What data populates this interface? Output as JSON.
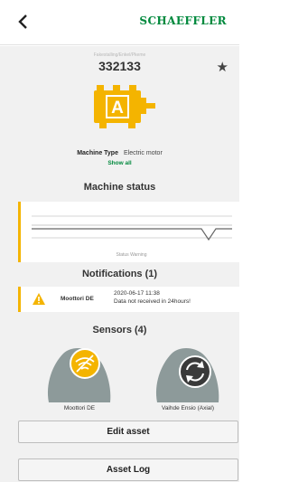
{
  "header": {
    "brand": "SCHAEFFLER",
    "back_icon": "back-chevron-icon"
  },
  "asset": {
    "breadcrumb": "Fakestalling/Enkel/Pkeme",
    "id": "332133",
    "favorite_icon": "star-icon",
    "type_label": "Machine Type",
    "type_value": "Electric motor",
    "show_all": "Show all",
    "icon": "electric-motor-icon",
    "icon_letter": "A"
  },
  "machine_status": {
    "title": "Machine status",
    "label": "Status Warning"
  },
  "notifications": {
    "title": "Notifications (1)",
    "items": [
      {
        "source": "Moottori DE",
        "time": "2020-06-17 11:38",
        "message": "Data not received in 24hours!",
        "icon": "warning-triangle-icon"
      }
    ]
  },
  "sensors": {
    "title": "Sensors (4)",
    "items": [
      {
        "label": "Moottori DE",
        "icon": "no-signal-icon",
        "badge_color": "#f4b400"
      },
      {
        "label": "Vaihde Ensio (Axial)",
        "icon": "sync-icon",
        "badge_color": "#3a3a3a"
      }
    ]
  },
  "actions": {
    "edit": "Edit asset",
    "log": "Asset Log"
  },
  "colors": {
    "accent_green": "#00893d",
    "warning_yellow": "#f4b400",
    "sensor_gray": "#8d9a9a"
  }
}
